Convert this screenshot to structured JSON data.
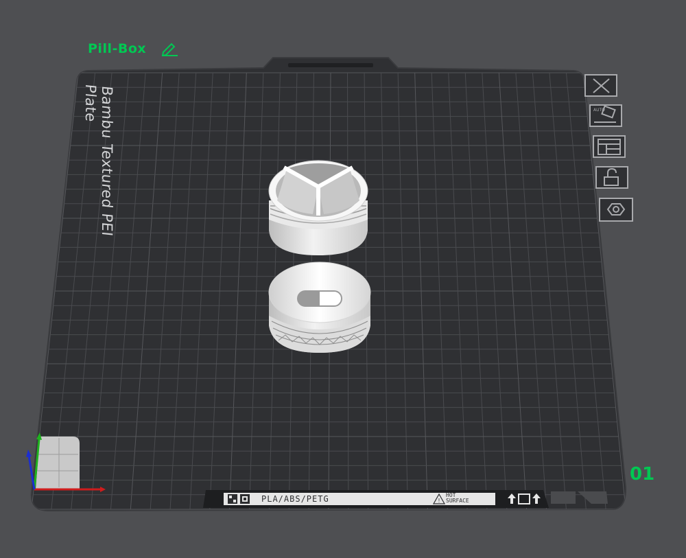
{
  "plate": {
    "name": "Pill-Box",
    "label": "Bambu Textured PEI Plate",
    "number": "01"
  },
  "bottom_strip": {
    "material": "PLA/ABS/PETG",
    "warning_line1": "HOT",
    "warning_line2": "SURFACE"
  },
  "toolbar_icons": [
    "close-icon",
    "auto-arrange-icon",
    "layout-icon",
    "lock-icon",
    "settings-hex-icon"
  ],
  "colors": {
    "accent": "#00c853",
    "plate": "#2f3033",
    "background": "#4e4f52"
  }
}
